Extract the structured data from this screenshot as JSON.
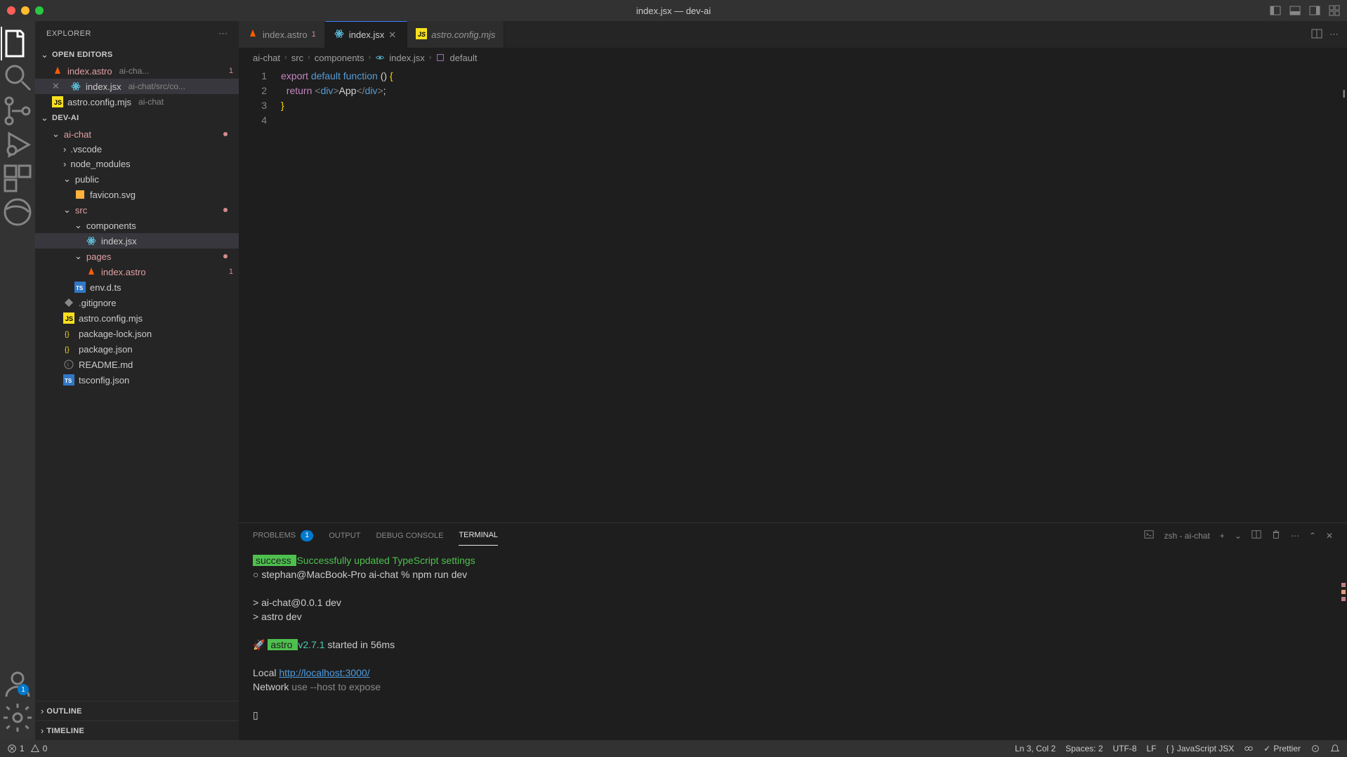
{
  "titlebar": {
    "title": "index.jsx — dev-ai"
  },
  "sidebar": {
    "title": "EXPLORER",
    "sections": {
      "open_editors": "OPEN EDITORS",
      "project": "DEV-AI",
      "outline": "OUTLINE",
      "timeline": "TIMELINE"
    }
  },
  "open_editors": [
    {
      "name": "index.astro",
      "suffix": "ai-cha...",
      "badge": "1"
    },
    {
      "name": "index.jsx",
      "suffix": "ai-chat/src/co..."
    },
    {
      "name": "astro.config.mjs",
      "suffix": "ai-chat"
    }
  ],
  "file_tree": {
    "root": "ai-chat",
    "items": [
      {
        "name": ".vscode",
        "type": "folder",
        "indent": 2
      },
      {
        "name": "node_modules",
        "type": "folder",
        "indent": 2
      },
      {
        "name": "public",
        "type": "folder",
        "indent": 2,
        "open": true
      },
      {
        "name": "favicon.svg",
        "type": "file",
        "indent": 3
      },
      {
        "name": "src",
        "type": "folder",
        "indent": 2,
        "open": true,
        "error": true
      },
      {
        "name": "components",
        "type": "folder",
        "indent": 3,
        "open": true
      },
      {
        "name": "index.jsx",
        "type": "file",
        "indent": 4,
        "selected": true
      },
      {
        "name": "pages",
        "type": "folder",
        "indent": 3,
        "open": true,
        "error": true
      },
      {
        "name": "index.astro",
        "type": "file",
        "indent": 4,
        "error": true,
        "badge": "1"
      },
      {
        "name": "env.d.ts",
        "type": "file",
        "indent": 3
      },
      {
        "name": ".gitignore",
        "type": "file",
        "indent": 2
      },
      {
        "name": "astro.config.mjs",
        "type": "file",
        "indent": 2
      },
      {
        "name": "package-lock.json",
        "type": "file",
        "indent": 2
      },
      {
        "name": "package.json",
        "type": "file",
        "indent": 2
      },
      {
        "name": "README.md",
        "type": "file",
        "indent": 2
      },
      {
        "name": "tsconfig.json",
        "type": "file",
        "indent": 2
      }
    ]
  },
  "tabs": [
    {
      "name": "index.astro",
      "badge": "1",
      "active": false
    },
    {
      "name": "index.jsx",
      "active": true
    },
    {
      "name": "astro.config.mjs",
      "active": false,
      "italic": true
    }
  ],
  "breadcrumbs": [
    "ai-chat",
    "src",
    "components",
    "index.jsx",
    "default"
  ],
  "code": {
    "lines": [
      "1",
      "2",
      "3",
      "4"
    ],
    "line1": {
      "export": "export",
      "default": "default",
      "function": "function",
      "parens": "()",
      "brace": "{"
    },
    "line2": {
      "return": "return",
      "open_tag": "<",
      "div": "div",
      "close_open": ">",
      "text": "App",
      "open_close": "</",
      "close_close": ">",
      "semi": ";"
    },
    "line3": {
      "brace": "}"
    }
  },
  "panel": {
    "tabs": {
      "problems": "PROBLEMS",
      "problems_badge": "1",
      "output": "OUTPUT",
      "debug": "DEBUG CONSOLE",
      "terminal": "TERMINAL"
    },
    "shell_label": "zsh - ai-chat"
  },
  "terminal": {
    "success_label": " success ",
    "success_msg": "Successfully updated TypeScript settings",
    "prompt": "stephan@MacBook-Pro ai-chat % npm run dev",
    "script1": "> ai-chat@0.0.1 dev",
    "script2": "> astro dev",
    "rocket": "🚀",
    "astro_label": " astro ",
    "version": "v2.7.1",
    "started": "started in 56ms",
    "local_label": "Local",
    "local_url": "http://localhost:3000/",
    "network_label": "Network",
    "network_msg": "use --host to expose",
    "cursor": "▯"
  },
  "status": {
    "errors": "1",
    "warnings": "0",
    "cursor_pos": "Ln 3, Col 2",
    "spaces": "Spaces: 2",
    "encoding": "UTF-8",
    "eol": "LF",
    "language": "JavaScript JSX",
    "prettier": "Prettier"
  },
  "account_badge": "1"
}
